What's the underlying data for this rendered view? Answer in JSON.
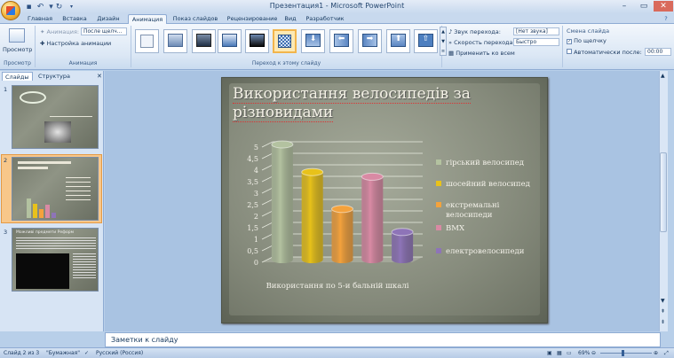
{
  "window": {
    "title": "Презентация1 - Microsoft PowerPoint"
  },
  "tabs": [
    "Главная",
    "Вставка",
    "Дизайн",
    "Анимация",
    "Показ слайдов",
    "Рецензирование",
    "Вид",
    "Разработчик"
  ],
  "ribbon": {
    "preview": {
      "label": "Просмотр",
      "group": "Просмотр"
    },
    "animation": {
      "anim_label": "Анимация:",
      "anim_value": "После щелч...",
      "custom": "Настройка анимации",
      "group": "Анимация"
    },
    "transition": {
      "group": "Переход к этому слайду",
      "sound_label": "Звук перехода:",
      "sound_value": "[Нет звука]",
      "speed_label": "Скорость перехода:",
      "speed_value": "Быстро",
      "apply_all": "Применить ко всем"
    },
    "advance": {
      "group": "Смена слайда",
      "on_click": "По щелчку",
      "auto_after": "Автоматически после:",
      "time": "00:00"
    }
  },
  "left_pane": {
    "tabs": [
      "Слайды",
      "Структура"
    ],
    "slides": [
      {
        "num": "1"
      },
      {
        "num": "2"
      },
      {
        "num": "3"
      }
    ],
    "slide3_title": "Можливі предмети Реформ"
  },
  "slide": {
    "title": "Використання велосипедів за різновидами",
    "chart_data": {
      "type": "bar",
      "categories": [
        "гірський велосипед",
        "шосейний велосипед",
        "екстремальні велосипеди",
        "BMX",
        "електровелосипеди"
      ],
      "values": [
        5,
        3.8,
        2.2,
        3.6,
        1.2
      ],
      "colors": [
        "#b3c2a0",
        "#e8c21a",
        "#f4a23c",
        "#d98aa4",
        "#8e74b8"
      ],
      "legend": [
        "гірський велосипед",
        "шосейний велосипед",
        "екстремальні велосипеди",
        "BMX",
        "електровелосипеди"
      ],
      "ylim": [
        0,
        5
      ],
      "yticks": [
        "0",
        "0,5",
        "1",
        "1,5",
        "2",
        "2,5",
        "3",
        "3,5",
        "4",
        "4,5",
        "5"
      ],
      "xlabel": "Використання по 5-и бальній шкалі"
    }
  },
  "notes": {
    "placeholder": "Заметки к слайду"
  },
  "status": {
    "slide": "Слайд 2 из 3",
    "theme": "\"Бумажная\"",
    "lang": "Русский (Россия)",
    "zoom": "69%"
  }
}
